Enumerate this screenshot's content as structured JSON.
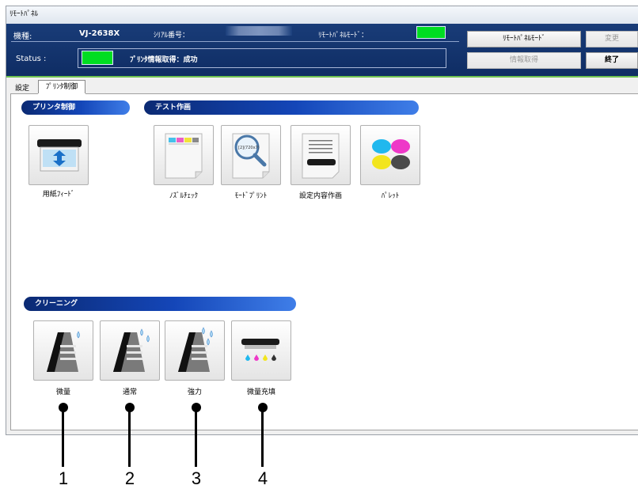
{
  "window": {
    "title": "ﾘﾓｰﾄﾊﾟﾈﾙ"
  },
  "header": {
    "model_label": "機種:",
    "model_value": "VJ-2638X",
    "serial_label": "ｼﾘｱﾙ番号：",
    "remote_mode_label": "ﾘﾓｰﾄﾊﾟﾈﾙﾓｰﾄﾞ：",
    "status_label": "Status :",
    "status_text": "ﾌﾟﾘﾝﾀ情報取得：成功",
    "indicator_color": "#00dd22"
  },
  "buttons": {
    "remote_mode": "ﾘﾓｰﾄﾊﾟﾈﾙﾓｰﾄﾞ",
    "change": "変更",
    "get_info": "情報取得",
    "exit": "終了"
  },
  "tabs": [
    "設定",
    "ﾌﾟﾘﾝﾀ制御"
  ],
  "sections": {
    "printer_control": "プリンタ制御",
    "test_print": "テスト作画",
    "cleaning": "クリーニング"
  },
  "printer_control_items": [
    {
      "label": "用紙ﾌｨｰﾄﾞ",
      "icon": "paper-feed-icon"
    }
  ],
  "test_print_items": [
    {
      "label": "ﾉｽﾞﾙﾁｪｯｸ",
      "icon": "nozzle-check-icon"
    },
    {
      "label": "ﾓｰﾄﾞﾌﾟﾘﾝﾄ",
      "icon": "mode-print-icon"
    },
    {
      "label": "設定内容作画",
      "icon": "settings-print-icon"
    },
    {
      "label": "ﾊﾟﾚｯﾄ",
      "icon": "palette-icon"
    }
  ],
  "mode_print_icon_text": "[2](720x7)",
  "cleaning_items": [
    {
      "label": "微量",
      "icon": "cleaning-light-icon"
    },
    {
      "label": "通常",
      "icon": "cleaning-normal-icon"
    },
    {
      "label": "強力",
      "icon": "cleaning-strong-icon"
    },
    {
      "label": "微量充填",
      "icon": "ink-fill-icon"
    }
  ],
  "callouts": [
    "1",
    "2",
    "3",
    "4"
  ],
  "colors": {
    "header_bg": "#193c78",
    "section_blue": "#1446b8",
    "accent_green": "#6fc251"
  }
}
